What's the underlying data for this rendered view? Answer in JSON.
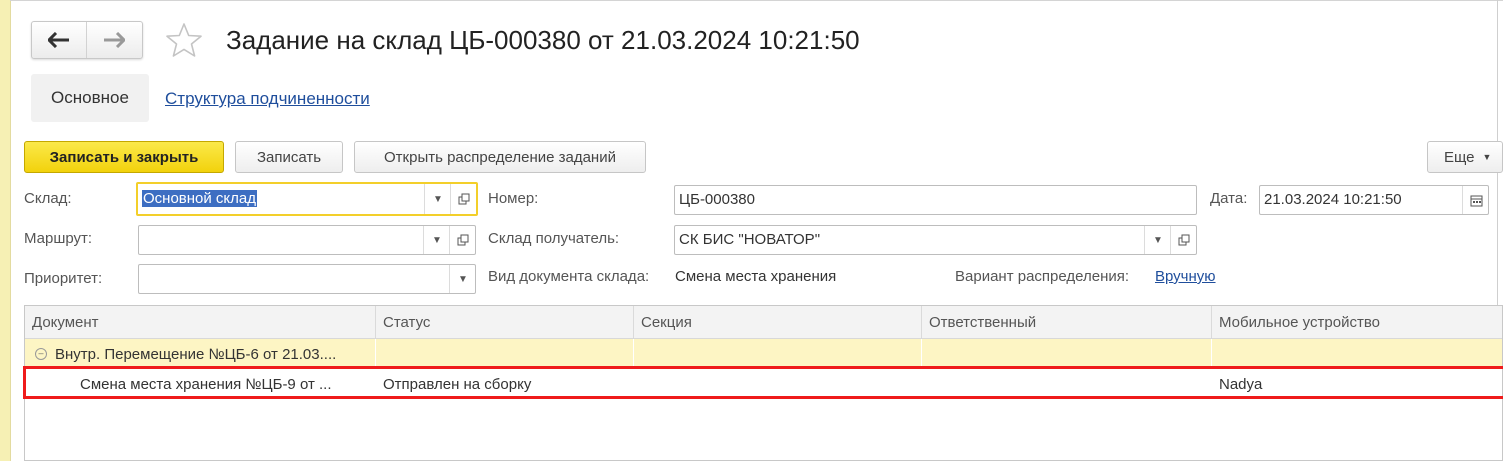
{
  "window": {
    "title": "Задание на склад ЦБ-000380 от 21.03.2024 10:21:50",
    "nav": {
      "back_icon": "arrow-left-icon",
      "forward_icon": "arrow-right-icon",
      "favorite_icon": "star-icon"
    }
  },
  "tabs": [
    {
      "label": "Основное",
      "active": true
    },
    {
      "label": "Структура подчиненности",
      "active": false
    }
  ],
  "toolbar": {
    "save_close": "Записать и закрыть",
    "save": "Записать",
    "open_distribution": "Открыть распределение заданий",
    "more": "Еще"
  },
  "form": {
    "warehouse_label": "Склад:",
    "warehouse_value": "Основной склад",
    "route_label": "Маршрут:",
    "route_value": "",
    "priority_label": "Приоритет:",
    "priority_value": "",
    "number_label": "Номер:",
    "number_value": "ЦБ-000380",
    "date_label": "Дата:",
    "date_value": "21.03.2024 10:21:50",
    "recipient_label": "Склад получатель:",
    "recipient_value": "СК БИС \"НОВАТОР\"",
    "doctype_label": "Вид документа склада:",
    "doctype_value": "Смена места хранения",
    "distribution_label": "Вариант распределения:",
    "distribution_value": "Вручную"
  },
  "table": {
    "columns": [
      "Документ",
      "Статус",
      "Секция",
      "Ответственный",
      "Мобильное устройство"
    ],
    "rows": [
      {
        "document": "Внутр. Перемещение №ЦБ-6 от 21.03....",
        "status": "",
        "section": "",
        "responsible": "",
        "device": "",
        "group": true
      },
      {
        "document": "Смена места хранения №ЦБ-9 от ...",
        "status": "Отправлен на сборку",
        "section": "",
        "responsible": "",
        "device": "Nadya",
        "group": false
      }
    ]
  },
  "colors": {
    "accent_yellow": "#f5d81b",
    "link_blue": "#1f4e9c",
    "highlight_red": "#ef1b1b",
    "group_row": "#fdf5c4"
  }
}
